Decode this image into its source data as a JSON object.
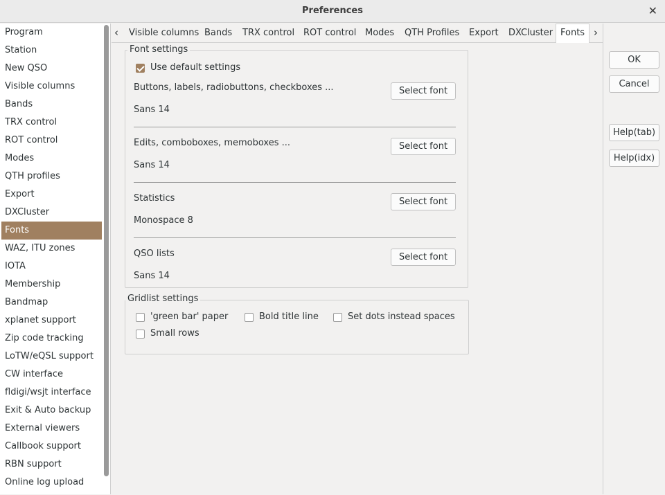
{
  "window": {
    "title": "Preferences"
  },
  "sidebar": {
    "items": [
      {
        "label": "Program"
      },
      {
        "label": "Station"
      },
      {
        "label": "New QSO"
      },
      {
        "label": "Visible columns"
      },
      {
        "label": "Bands"
      },
      {
        "label": "TRX control"
      },
      {
        "label": "ROT control"
      },
      {
        "label": "Modes"
      },
      {
        "label": "QTH profiles"
      },
      {
        "label": "Export"
      },
      {
        "label": "DXCluster"
      },
      {
        "label": "Fonts"
      },
      {
        "label": "WAZ, ITU zones"
      },
      {
        "label": "IOTA"
      },
      {
        "label": "Membership"
      },
      {
        "label": "Bandmap"
      },
      {
        "label": "xplanet support"
      },
      {
        "label": "Zip code tracking"
      },
      {
        "label": "LoTW/eQSL support"
      },
      {
        "label": "CW interface"
      },
      {
        "label": "fldigi/wsjt interface"
      },
      {
        "label": "Exit & Auto backup"
      },
      {
        "label": "External viewers"
      },
      {
        "label": "Callbook support"
      },
      {
        "label": "RBN support"
      },
      {
        "label": "Online log upload"
      }
    ],
    "selected": "Fonts"
  },
  "tabs": {
    "prev_arrow": "‹",
    "next_arrow": "›",
    "items": [
      {
        "label": "Visible columns"
      },
      {
        "label": "Bands"
      },
      {
        "label": "TRX control"
      },
      {
        "label": "ROT control"
      },
      {
        "label": "Modes"
      },
      {
        "label": "QTH Profiles"
      },
      {
        "label": "Export"
      },
      {
        "label": "DXCluster"
      },
      {
        "label": "Fonts"
      }
    ],
    "active": "Fonts"
  },
  "font_settings": {
    "title": "Font settings",
    "use_default_label": "Use default settings",
    "use_default_checked": true,
    "select_font_label": "Select font",
    "rows": [
      {
        "label": "Buttons, labels, radiobuttons, checkboxes ...",
        "value": "Sans 14"
      },
      {
        "label": "Edits, comboboxes, memoboxes ...",
        "value": "Sans 14"
      },
      {
        "label": "Statistics",
        "value": "Monospace 8"
      },
      {
        "label": "QSO lists",
        "value": "Sans 14"
      }
    ]
  },
  "gridlist_settings": {
    "title": "Gridlist settings",
    "options": [
      {
        "label": "'green bar' paper",
        "checked": false
      },
      {
        "label": "Bold title line",
        "checked": false
      },
      {
        "label": "Set dots instead spaces",
        "checked": false
      },
      {
        "label": "Small rows",
        "checked": false
      }
    ]
  },
  "buttons": {
    "ok": "OK",
    "cancel": "Cancel",
    "help_tab": "Help(tab)",
    "help_idx": "Help(idx)"
  },
  "colors": {
    "accent": "#a08060",
    "window_bg": "#f2f1f0"
  }
}
